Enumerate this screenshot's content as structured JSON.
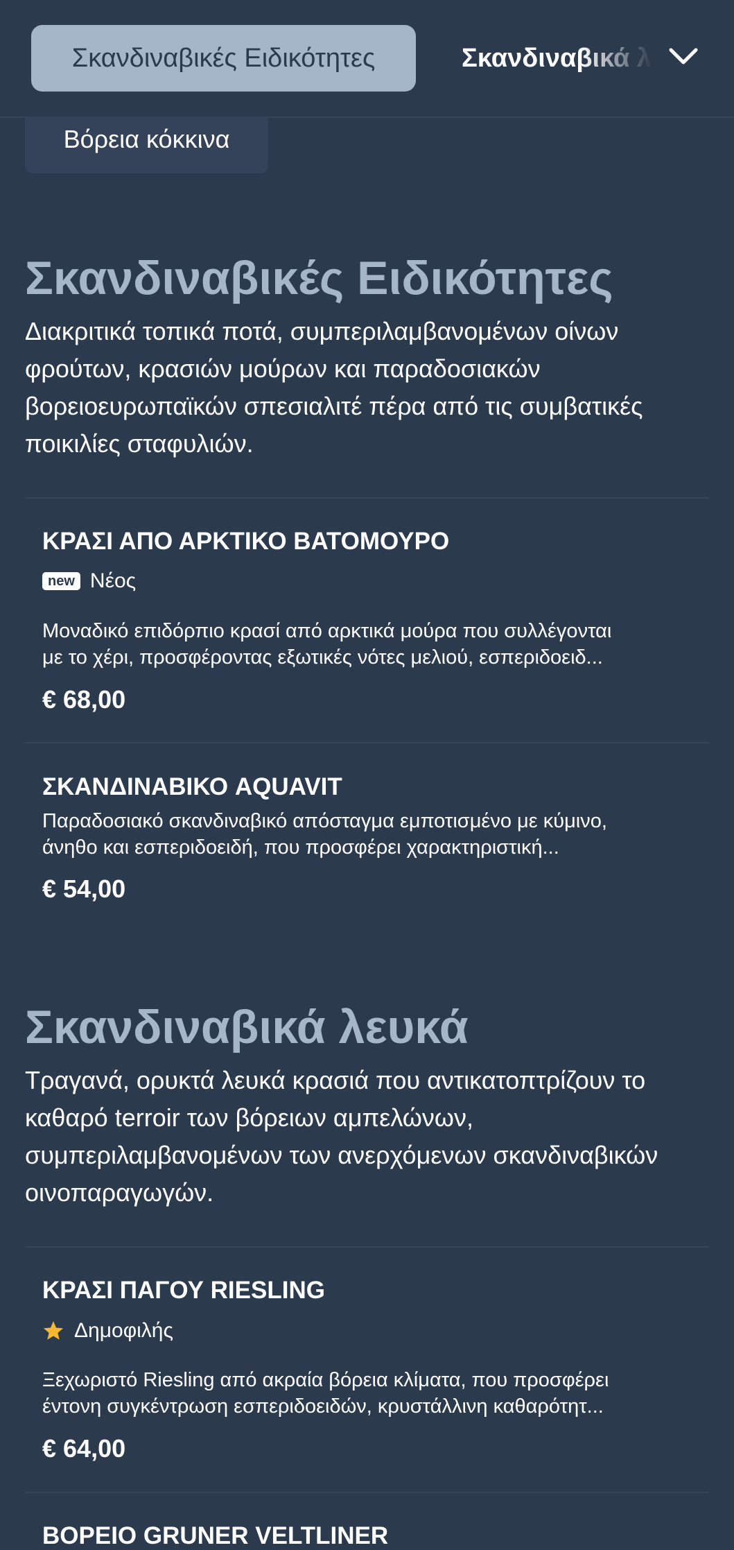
{
  "header": {
    "active_tab": "Σκανδιναβικές Ειδικότητες",
    "next_tab": "Σκανδιναβικά λευκά",
    "chevron_icon": "chevron-down-icon"
  },
  "chip": {
    "label": "Βόρεια κόκκινα"
  },
  "sections": [
    {
      "title": "Σκανδιναβικές Ειδικότητες",
      "description": "Διακριτικά τοπικά ποτά, συμπεριλαμβανομένων οίνων φρούτων, κρασιών μούρων και παραδοσιακών βορειοευρωπαϊκών σπεσιαλιτέ πέρα από τις συμβατικές ποικιλίες σταφυλιών.",
      "items": [
        {
          "name": "ΚΡΑΣΙ ΑΠΟ ΑΡΚΤΙΚΟ ΒΑΤΟΜΟΥΡΟ",
          "badge_tag": "new",
          "badge_label": "Νέος",
          "desc_line1": "Μοναδικό επιδόρπιο κρασί από αρκτικά μούρα που συλλέγονται",
          "desc_line2": "με το χέρι, προσφέροντας εξωτικές νότες μελιού, εσπεριδοειδ...",
          "price": "€ 68,00"
        },
        {
          "name": "ΣΚΑΝΔΙΝΑΒΙΚΟ AQUAVIT",
          "desc_line1": "Παραδοσιακό σκανδιναβικό απόσταγμα εμποτισμένο με κύμινο,",
          "desc_line2": "άνηθο και εσπεριδοειδή, που προσφέρει χαρακτηριστική...",
          "price": "€ 54,00"
        }
      ]
    },
    {
      "title": "Σκανδιναβικά λευκά",
      "description": "Τραγανά, ορυκτά λευκά κρασιά που αντικατοπτρίζουν το καθαρό terroir των βόρειων αμπελώνων, συμπεριλαμβανομένων των ανερχόμενων σκανδιναβικών οινοπαραγωγών.",
      "items": [
        {
          "name": "ΚΡΑΣΙ ΠΑΓΟΥ RIESLING",
          "badge_icon": "star-icon",
          "badge_label": "Δημοφιλής",
          "desc_line1": "Ξεχωριστό Riesling από ακραία βόρεια κλίματα, που προσφέρει",
          "desc_line2": "έντονη συγκέντρωση εσπεριδοειδών, κρυστάλλινη καθαρότητ...",
          "price": "€ 64,00"
        },
        {
          "name": "ΒΟΡΕΙΟ GRUNER VELTLINER"
        }
      ]
    }
  ],
  "colors": {
    "background": "#2c3a4d",
    "accent": "#a6b6c9",
    "chip_bg": "#34435a",
    "star": "#f5b82e"
  }
}
